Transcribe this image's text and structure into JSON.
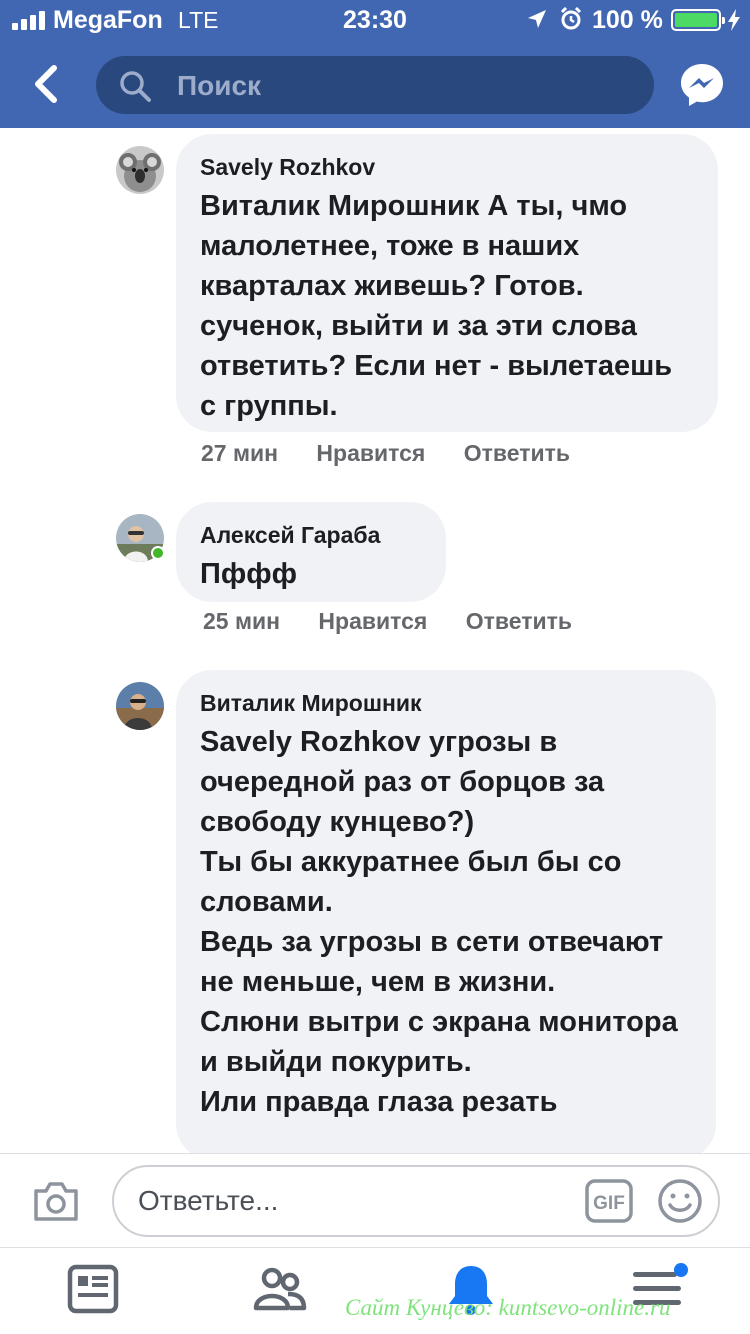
{
  "status_bar": {
    "carrier": "MegaFon",
    "network": "LTE",
    "time": "23:30",
    "battery": "100 %"
  },
  "header": {
    "search_placeholder": "Поиск",
    "back_icon": "chevron-left-icon",
    "messenger_icon": "messenger-icon"
  },
  "comments": [
    {
      "author": "Savely Rozhkov",
      "mention": "Виталик Мирошник",
      "text": " А ты, чмо малолетнее, тоже в наших кварталах живешь? Готов. сученок, выйти и за эти слова ответить? Если нет - вылетаешь с группы.",
      "time": "27 мин",
      "like_label": "Нравится",
      "reply_label": "Ответить"
    },
    {
      "author": "Алексей Гараба",
      "mention": "",
      "text": "Пффф",
      "time": "25 мин",
      "like_label": "Нравится",
      "reply_label": "Ответить",
      "online": true
    },
    {
      "author": "Виталик Мирошник",
      "mention": "Savely Rozhkov",
      "text": "  угрозы в очередной раз от борцов за свободу кунцево?)\nТы бы аккуратнее был бы со словами.\nВедь за угрозы в сети отвечают не меньше, чем в жизни.\nСлюни вытри с экрана монитора и выйди покурить.\nИли правда глаза резать"
    }
  ],
  "reply_bar": {
    "placeholder": "Ответьте...",
    "gif_label": "GIF"
  },
  "tabbar": {
    "items": [
      "news-feed-icon",
      "friends-icon",
      "notifications-icon",
      "menu-icon"
    ]
  },
  "watermark": "Сайт Кунцево:  kuntsevo-online.ru",
  "colors": {
    "header_bg": "#4267b2",
    "search_bg": "#29487d",
    "bubble_bg": "#f0f2f5",
    "meta_text": "#65676b",
    "online": "#42b72a",
    "notif_blue": "#1877f2",
    "battery_green": "#4cd964",
    "watermark_green": "#7fe37b"
  }
}
